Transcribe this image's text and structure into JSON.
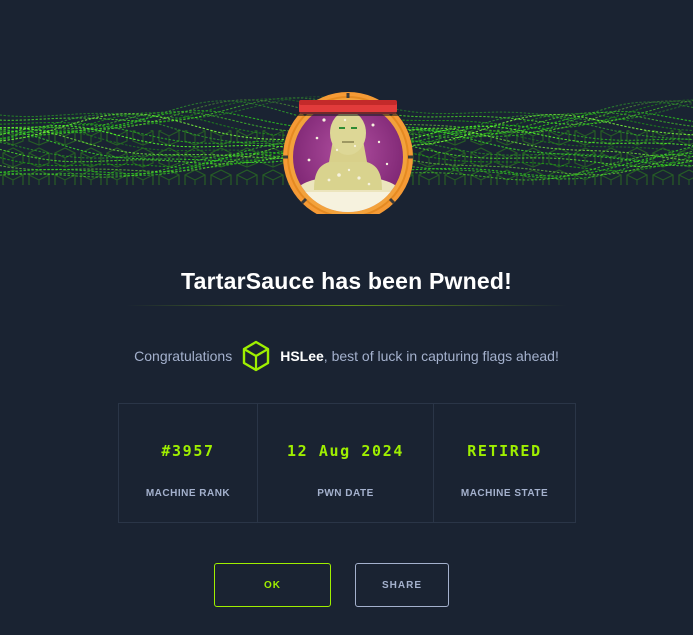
{
  "machine": {
    "name": "TartarSauce"
  },
  "title": "TartarSauce has been Pwned!",
  "congrats": {
    "prefix": "Congratulations",
    "username": "HSLee",
    "suffix": ", best of luck in capturing flags ahead!"
  },
  "stats": [
    {
      "value": "#3957",
      "label": "MACHINE RANK"
    },
    {
      "value": "12 Aug 2024",
      "label": "PWN DATE"
    },
    {
      "value": "RETIRED",
      "label": "MACHINE STATE"
    }
  ],
  "buttons": {
    "ok": "OK",
    "share": "SHARE"
  },
  "icons": {
    "avatar": "machine-avatar-icon",
    "user": "hexagon-cube-icon"
  },
  "colors": {
    "background": "#1a2332",
    "accent": "#9fef00",
    "muted": "#a4b1cd",
    "avatar_ring": "#f7a03a"
  }
}
